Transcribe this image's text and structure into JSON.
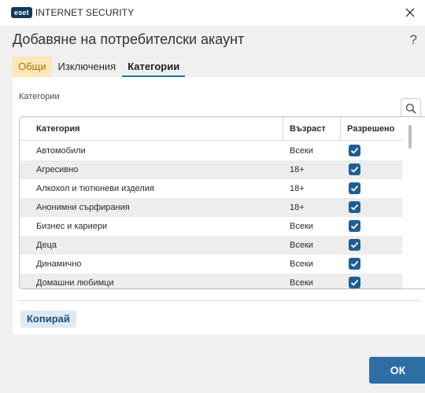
{
  "app": {
    "logo_badge": "eset",
    "product_name": "INTERNET SECURITY",
    "close_icon": "close-icon"
  },
  "header": {
    "title": "Добавяне на потребителски акаунт",
    "help_label": "?"
  },
  "tabs": [
    {
      "label": "Общи"
    },
    {
      "label": "Изключения"
    },
    {
      "label": "Категории",
      "active": true
    }
  ],
  "panel": {
    "section_label": "Категории",
    "search_icon": "search-icon"
  },
  "table": {
    "columns": [
      "Категория",
      "Възраст",
      "Разрешено"
    ],
    "rows": [
      {
        "category": "Автомобили",
        "age": "Всеки",
        "allowed": true
      },
      {
        "category": "Агресивно",
        "age": "18+",
        "allowed": true
      },
      {
        "category": "Алкохол и тютюневи изделия",
        "age": "18+",
        "allowed": true
      },
      {
        "category": "Анонимни сърфирания",
        "age": "18+",
        "allowed": true
      },
      {
        "category": "Бизнес и кариери",
        "age": "Всеки",
        "allowed": true
      },
      {
        "category": "Деца",
        "age": "Всеки",
        "allowed": true
      },
      {
        "category": "Динамично",
        "age": "Всеки",
        "allowed": true
      },
      {
        "category": "Домашни любимци",
        "age": "Всеки",
        "allowed": true
      }
    ]
  },
  "actions": {
    "copy_label": "Копирай",
    "ok_label": "ОК"
  },
  "colors": {
    "accent": "#2d6ea4",
    "checkbox": "#1d5e96",
    "tab_highlight": "#fbe7b7"
  }
}
